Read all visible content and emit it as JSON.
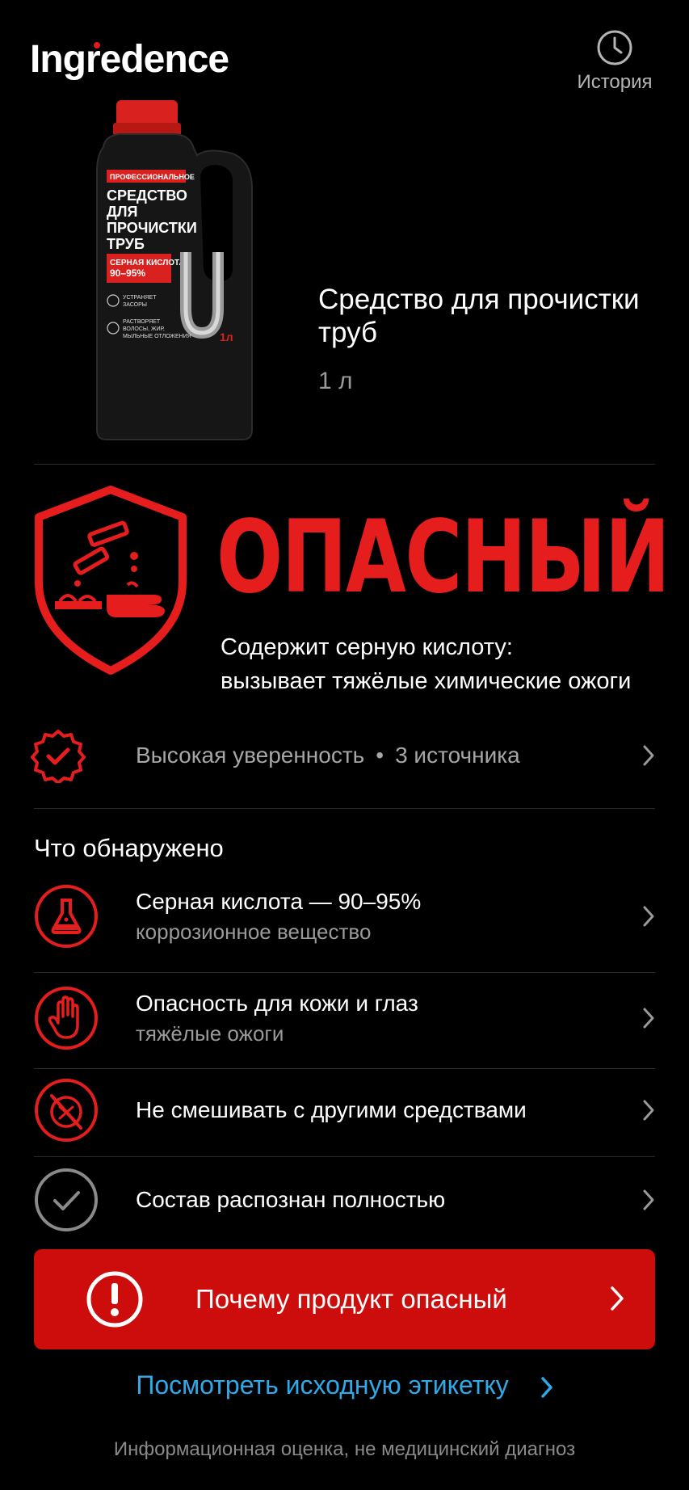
{
  "app": {
    "logo_text": "Ingredence",
    "history_label": "История"
  },
  "product": {
    "title": "Средство для прочистки труб",
    "volume": "1 л",
    "bottle_label": {
      "badge": "ПРОФЕССИОНАЛЬНОЕ",
      "name_lines": [
        "СРЕДСТВО",
        "ДЛЯ",
        "ПРОЧИСТКИ",
        "ТРУБ"
      ],
      "acid_lines": [
        "СЕРНАЯ КИСЛОТА",
        "90–95%"
      ],
      "feature_1": [
        "УСТРАНЯЕТ",
        "ЗАСОРЫ"
      ],
      "feature_2": [
        "РАСТВОРЯЕТ",
        "ВОЛОСЫ, ЖИР,",
        "МЫЛЬНЫЕ ОТЛОЖЕНИЯ"
      ],
      "volume": "1л"
    }
  },
  "verdict": {
    "label": "ОПАСНЫЙ",
    "description_line1": "Содержит серную кислоту:",
    "description_line2": "вызывает тяжёлые химические ожоги",
    "color": "#e51d1d"
  },
  "confidence": {
    "level": "Высокая уверенность",
    "separator": "•",
    "sources": "3 источника"
  },
  "findings": {
    "title": "Что обнаружено",
    "items": [
      {
        "title": "Серная кислота — 90–95%",
        "subtitle": "коррозионное вещество",
        "icon": "flask-icon"
      },
      {
        "title": "Опасность для кожи и глаз",
        "subtitle": "тяжёлые ожоги",
        "icon": "hand-stop-icon"
      },
      {
        "title": "Не смешивать с другими средствами",
        "subtitle": "",
        "icon": "no-mix-icon"
      },
      {
        "title": "Состав распознан полностью",
        "subtitle": "",
        "icon": "check-circle-icon"
      }
    ]
  },
  "cta": {
    "label": "Почему продукт опасный",
    "color": "#cd0c0c"
  },
  "link": {
    "label": "Посмотреть исходную этикетку",
    "color": "#2fa9e8"
  },
  "disclaimer": "Информационная оценка, не медицинский диагноз"
}
